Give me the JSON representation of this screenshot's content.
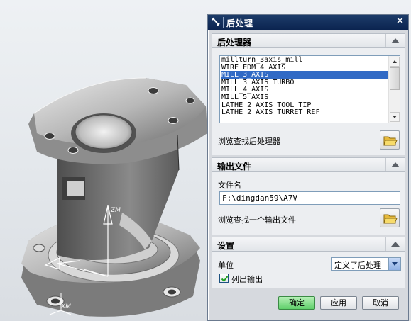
{
  "dialog": {
    "title": "后处理",
    "close_glyph": "✕",
    "colors": {
      "titlebar": "#0b2450",
      "selection": "#316ac5",
      "ok_button": "#5fcf6a"
    }
  },
  "postprocessor_section": {
    "title": "后处理器",
    "items": [
      "millturn_3axis_mill",
      "WIRE_EDM_4_AXIS",
      "MILL_3_AXIS",
      "MILL_3_AXIS_TURBO",
      "MILL_4_AXIS",
      "MILL_5_AXIS",
      "LATHE_2_AXIS_TOOL_TIP",
      "LATHE_2_AXIS_TURRET_REF"
    ],
    "selected_item": "MILL_3_AXIS",
    "browse_label": "浏览查找后处理器",
    "browse_icon": "folder-open-icon"
  },
  "output_section": {
    "title": "输出文件",
    "filename_label": "文件名",
    "filename_value": "F:\\dingdan59\\A7V",
    "browse_label": "浏览查找一个输出文件",
    "browse_icon": "folder-open-icon"
  },
  "settings_section": {
    "title": "设置",
    "units_label": "单位",
    "units_value": "定义了后处理",
    "list_output_label": "列出输出",
    "list_output_checked": true
  },
  "buttons": {
    "ok": "确定",
    "apply": "应用",
    "cancel": "取消"
  },
  "viewport": {
    "axis_labels": {
      "z": "ZM",
      "x": "XM"
    }
  }
}
